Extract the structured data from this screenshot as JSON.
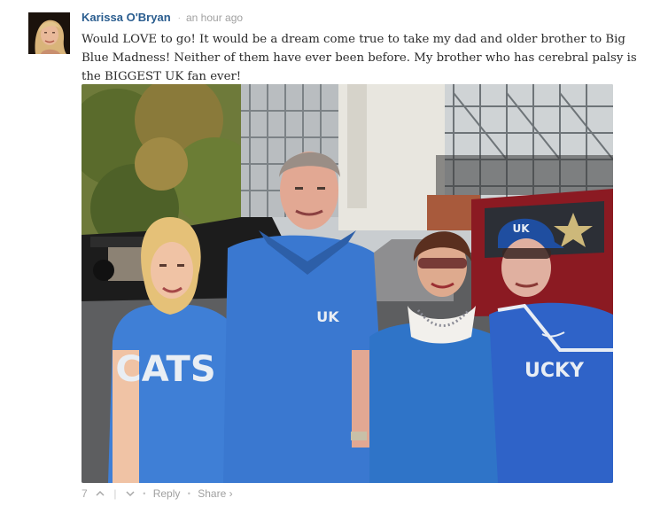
{
  "comment": {
    "author": "Karissa O'Bryan",
    "separator": "·",
    "time": "an hour ago",
    "text": "Would LOVE to go! It would be a dream come true to take my dad and older brother to Big Blue Madness! Neither of them have ever been before. My brother who has cerebral palsy is the BIGGEST UK fan ever!",
    "photo": {
      "shirt_text": "CATS",
      "polo_logo": "UK",
      "cap_logo": "UK",
      "jersey_text": "UCKY"
    },
    "footer": {
      "votes": "7",
      "divider": "|",
      "bullet": "•",
      "reply_label": "Reply",
      "share_label": "Share ›"
    }
  }
}
